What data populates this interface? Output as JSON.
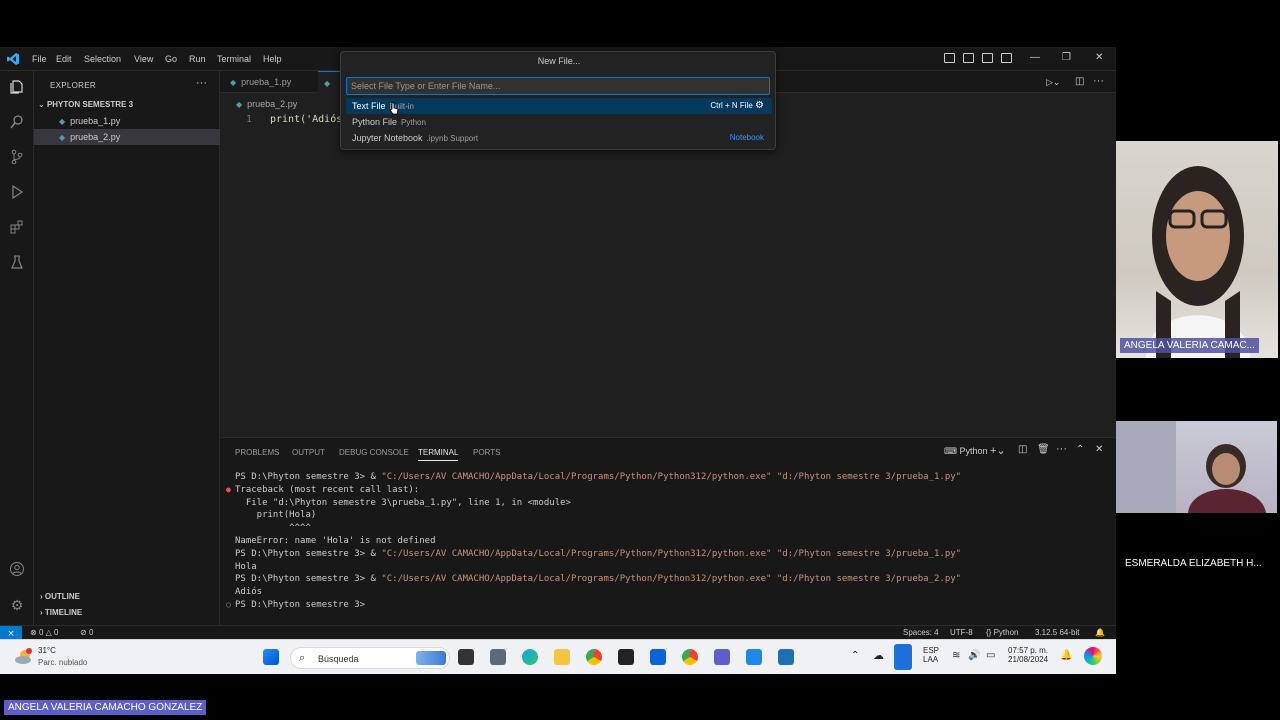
{
  "titlebar": {
    "menu": [
      "File",
      "Edit",
      "Selection",
      "View",
      "Go",
      "Run",
      "Terminal",
      "Help"
    ]
  },
  "quickpick": {
    "title": "New File...",
    "placeholder": "Select File Type or Enter File Name...",
    "items": [
      {
        "label": "Text File",
        "desc": "Built-in",
        "right": "Ctrl + N  File"
      },
      {
        "label": "Python File",
        "desc": "Python",
        "right": ""
      },
      {
        "label": "Jupyter Notebook",
        "desc": ".ipynb Support",
        "right": "Notebook"
      }
    ]
  },
  "sidebar": {
    "header": "EXPLORER",
    "folder": "PHYTON SEMESTRE 3",
    "files": [
      "prueba_1.py",
      "prueba_2.py"
    ],
    "outline": "OUTLINE",
    "timeline": "TIMELINE"
  },
  "editor": {
    "tabs": [
      "prueba_1.py",
      "prueba_2.py"
    ],
    "breadcrumb": "prueba_2.py",
    "line_number": "1",
    "code": "print('Adiós"
  },
  "panel": {
    "tabs": [
      "PROBLEMS",
      "OUTPUT",
      "DEBUG CONSOLE",
      "TERMINAL",
      "PORTS"
    ],
    "active_tab": "TERMINAL",
    "shell_label": "Python",
    "lines": [
      {
        "prompt": "PS D:\\Phyton semestre 3> & ",
        "path": "\"C:/Users/AV CAMACHO/AppData/Local/Programs/Python/Python312/python.exe\" \"d:/Phyton semestre 3/prueba_1.py\""
      },
      {
        "text": "Traceback (most recent call last):"
      },
      {
        "text": "  File \"d:\\Phyton semestre 3\\prueba_1.py\", line 1, in <module>"
      },
      {
        "text": "    print(Hola)"
      },
      {
        "text": "          ^^^^"
      },
      {
        "text": "NameError: name 'Hola' is not defined"
      },
      {
        "prompt": "PS D:\\Phyton semestre 3> & ",
        "path": "\"C:/Users/AV CAMACHO/AppData/Local/Programs/Python/Python312/python.exe\" \"d:/Phyton semestre 3/prueba_1.py\""
      },
      {
        "text": "Hola"
      },
      {
        "prompt": "PS D:\\Phyton semestre 3> & ",
        "path": "\"C:/Users/AV CAMACHO/AppData/Local/Programs/Python/Python312/python.exe\" \"d:/Phyton semestre 3/prueba_2.py\""
      },
      {
        "text": "Adiós"
      },
      {
        "text": "PS D:\\Phyton semestre 3>"
      }
    ]
  },
  "statusbar": {
    "errors": "0",
    "warnings": "0",
    "ports": "0",
    "spaces": "Spaces: 4",
    "encoding": "UTF-8",
    "language": "Python",
    "interpreter": "3.12.5 64-bit"
  },
  "taskbar": {
    "weather_temp": "31°C",
    "weather_desc": "Parc. nublado",
    "search_label": "Búsqueda",
    "lang": "ESP",
    "lang2": "LAA",
    "time": "07:57 p. m.",
    "date": "21/08/2024"
  },
  "participants": {
    "tile1_name": "ANGELA VALERIA CAMAC...",
    "tile2_name": "ESMERALDA ELIZABETH H...",
    "bottom_name": "ANGELA VALERIA CAMACHO GONZALEZ"
  },
  "colors": {
    "accent": "#0078d4",
    "terminal_path": "#ce9178",
    "error_dot": "#f14c4c"
  }
}
